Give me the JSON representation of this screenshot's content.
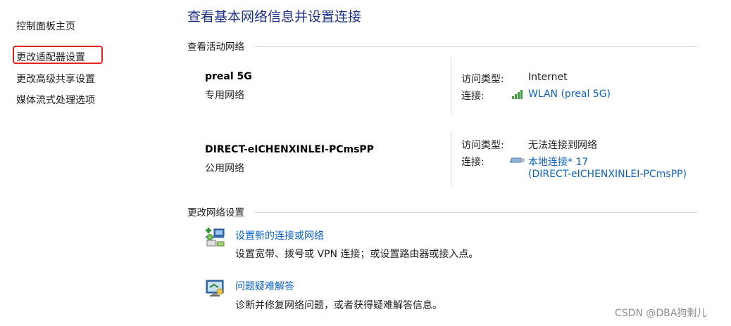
{
  "sidebar": {
    "items": [
      {
        "label": "控制面板主页"
      },
      {
        "label": "更改适配器设置"
      },
      {
        "label": "更改高级共享设置"
      },
      {
        "label": "媒体流式处理选项"
      }
    ]
  },
  "main": {
    "title": "查看基本网络信息并设置连接",
    "active_section_title": "查看活动网络",
    "networks": [
      {
        "name": "preal 5G",
        "type": "专用网络",
        "access_label": "访问类型:",
        "access_value": "Internet",
        "connection_label": "连接:",
        "connection_icon": "wifi-signal-icon",
        "connection_value": "WLAN (preal 5G)"
      },
      {
        "name": "DIRECT-eICHENXINLEI-PCmsPP",
        "type": "公用网络",
        "access_label": "访问类型:",
        "access_value": "无法连接到网络",
        "connection_label": "连接:",
        "connection_icon": "ethernet-cable-icon",
        "connection_value_line1": "本地连接* 17",
        "connection_value_line2": "(DIRECT-eICHENXINLEI-PCmsPP)"
      }
    ],
    "change_section_title": "更改网络设置",
    "actions": [
      {
        "icon": "new-connection-icon",
        "title": "设置新的连接或网络",
        "description": "设置宽带、拨号或 VPN 连接；或设置路由器或接入点。"
      },
      {
        "icon": "troubleshoot-icon",
        "title": "问题疑难解答",
        "description": "诊断并修复网络问题，或者获得疑难解答信息。"
      }
    ]
  },
  "watermark": "CSDN @DBA狗剩儿",
  "colors": {
    "link": "#0d63c6",
    "title": "#1e3287",
    "highlight": "#e8231c"
  }
}
